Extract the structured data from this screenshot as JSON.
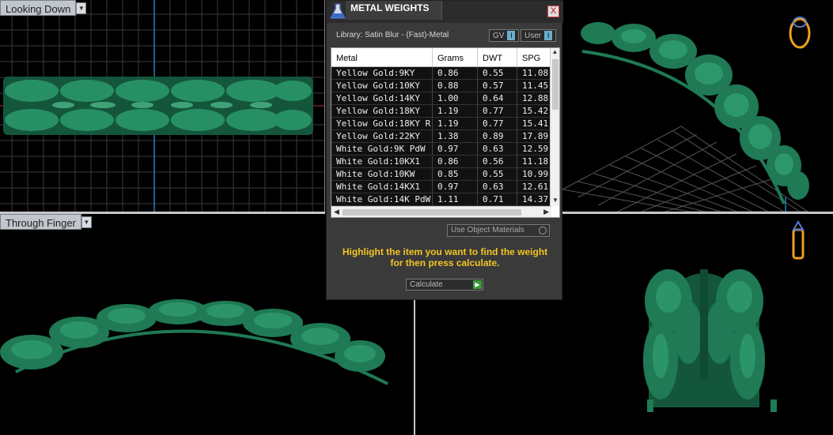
{
  "viewports": {
    "top_left_label": "Looking Down",
    "bottom_left_label": "Through Finger"
  },
  "dialog": {
    "title": "METAL WEIGHTS",
    "close_glyph": "X",
    "library_label": "Library: Satin Blur - (Fast)-Metal",
    "toggle_gv": "GV",
    "toggle_user": "User",
    "columns": [
      "Metal",
      "Grams",
      "DWT",
      "SPG"
    ],
    "rows": [
      [
        "Yellow Gold:9KY",
        "0.86",
        "0.55",
        "11.08"
      ],
      [
        "Yellow Gold:10KY",
        "0.88",
        "0.57",
        "11.45"
      ],
      [
        "Yellow Gold:14KY",
        "1.00",
        "0.64",
        "12.88"
      ],
      [
        "Yellow Gold:18KY",
        "1.19",
        "0.77",
        "15.42"
      ],
      [
        "Yellow Gold:18KY R...",
        "1.19",
        "0.77",
        "15.41"
      ],
      [
        "Yellow Gold:22KY",
        "1.38",
        "0.89",
        "17.89"
      ],
      [
        "White Gold:9K PdW",
        "0.97",
        "0.63",
        "12.59"
      ],
      [
        "White Gold:10KX1",
        "0.86",
        "0.56",
        "11.18"
      ],
      [
        "White Gold:10KW",
        "0.85",
        "0.55",
        "10.99"
      ],
      [
        "White Gold:14KX1",
        "0.97",
        "0.63",
        "12.61"
      ],
      [
        "White Gold:14K PdW",
        "1.11",
        "0.71",
        "14.37"
      ]
    ],
    "use_object_materials": "Use Object Materials",
    "hint": "Highlight the item you want to find the weight for then press calculate.",
    "calculate_label": "Calculate"
  },
  "colors": {
    "jewel_green": "#1f7a55",
    "hint_yellow": "#f2c522",
    "accent_blue": "#6aaecb"
  }
}
